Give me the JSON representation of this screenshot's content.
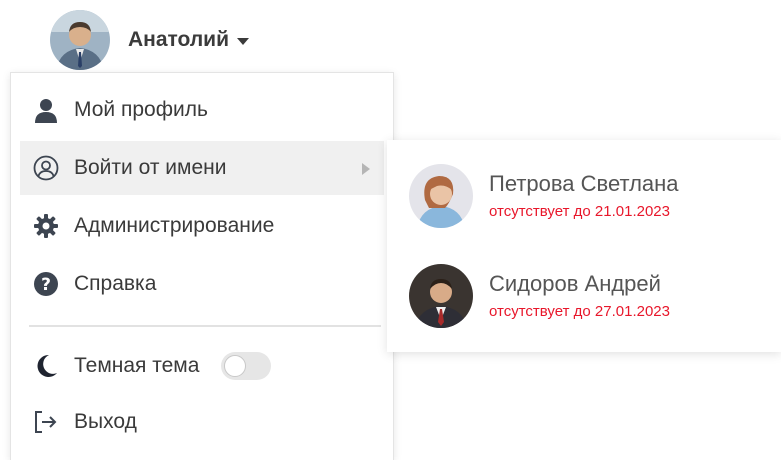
{
  "user": {
    "name": "Анатолий",
    "avatar_icon": "user-avatar-photo"
  },
  "menu": {
    "items": [
      {
        "label": "Мой профиль",
        "icon": "person-icon"
      },
      {
        "label": "Войти от имени",
        "icon": "user-circle-icon",
        "has_submenu": true,
        "active": true
      },
      {
        "label": "Администрирование",
        "icon": "gear-icon"
      },
      {
        "label": "Справка",
        "icon": "help-icon"
      }
    ],
    "theme": {
      "label": "Темная тема",
      "icon": "moon-icon",
      "enabled": false
    },
    "logout": {
      "label": "Выход",
      "icon": "logout-icon"
    }
  },
  "impersonate": {
    "users": [
      {
        "name": "Петрова Светлана",
        "status": "отсутствует до 21.01.2023"
      },
      {
        "name": "Сидоров Андрей",
        "status": "отсутствует до 27.01.2023"
      }
    ]
  },
  "colors": {
    "status_red": "#e8172b",
    "active_bg": "#f0f0f0",
    "icon_dark": "#3d4551"
  }
}
